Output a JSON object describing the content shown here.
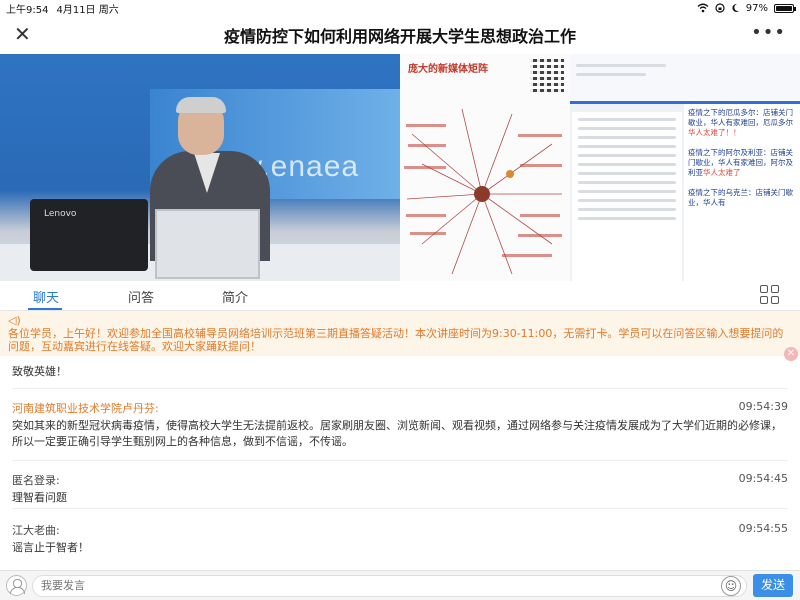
{
  "status_bar": {
    "time": "上午9:54",
    "date": "4月11日 周六",
    "battery": "97%",
    "battery_level": 0.97
  },
  "navbar": {
    "title": "疫情防控下如何利用网络开展大学生思想政治工作",
    "close_icon": "close-icon",
    "more_icon": "more-icon"
  },
  "video": {
    "watermark": "www.enaea",
    "laptop_logo": "Lenovo",
    "slide_title": "庞大的新媒体矩阵",
    "news": [
      {
        "text": "疫情之下的厄瓜多尔：店铺关门歇业，华人有家难回，厄瓜多尔",
        "highlight": "华人太难了！！"
      },
      {
        "text": "疫情之下的阿尔及利亚：店铺关门歇业，华人有家难回，阿尔及利亚",
        "highlight": "华人太难了"
      },
      {
        "text": "疫情之下的乌克兰：店铺关门歇业，华人有",
        "highlight": ""
      }
    ]
  },
  "tabs": [
    {
      "label": "聊天",
      "active": true
    },
    {
      "label": "问答",
      "active": false
    },
    {
      "label": "简介",
      "active": false
    }
  ],
  "notice": {
    "text": "各位学员，上午好！欢迎参加全国高校辅导员网络培训示范班第三期直播答疑活动！本次讲座时间为9:30-11:00，无需打卡。学员可以在问答区输入想要提问的问题，互动嘉宾进行在线答疑。欢迎大家踊跃提问！"
  },
  "chat": {
    "partial_message": "致敬英雄！",
    "messages": [
      {
        "name": "河南建筑职业技术学院卢丹芬:",
        "time": "09:54:39",
        "body": "突如其来的新型冠状病毒疫情，使得高校大学生无法提前返校。居家刷朋友圈、浏览新闻、观看视频，通过网络参与关注疫情发展成为了大学们近期的必修课，所以一定要正确引导学生甄别网上的各种信息，做到不信谣，不传谣。"
      },
      {
        "name": "匿名登录:",
        "time": "09:54:45",
        "body": "理智看问题"
      },
      {
        "name": "江大老曲:",
        "time": "09:54:55",
        "body": "谣言止于智者！"
      }
    ]
  },
  "input_bar": {
    "placeholder": "我要发言",
    "send_label": "发送"
  },
  "colors": {
    "accent": "#2b7bd6",
    "notice_text": "#e07a2b",
    "send_button": "#3c8fe6"
  }
}
